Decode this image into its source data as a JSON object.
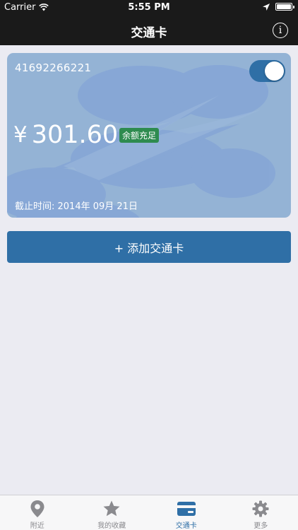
{
  "status_bar": {
    "carrier": "Carrier",
    "time": "5:55 PM"
  },
  "nav": {
    "title": "交通卡",
    "info_icon": "i"
  },
  "card": {
    "number": "41692266221",
    "currency": "¥",
    "balance": "301.60",
    "badge": "余额充足",
    "expiry": "截止时间: 2014年 09月 21日",
    "enabled": true
  },
  "add_button": {
    "label": "+ 添加交通卡"
  },
  "tabs": [
    {
      "label": "附近",
      "icon": "location-pin-icon"
    },
    {
      "label": "我的收藏",
      "icon": "star-icon"
    },
    {
      "label": "交通卡",
      "icon": "card-icon",
      "active": true
    },
    {
      "label": "更多",
      "icon": "gear-icon"
    }
  ],
  "colors": {
    "accent": "#2f6fa6",
    "card": "#94b3d5",
    "badge": "#2e8b4f"
  }
}
